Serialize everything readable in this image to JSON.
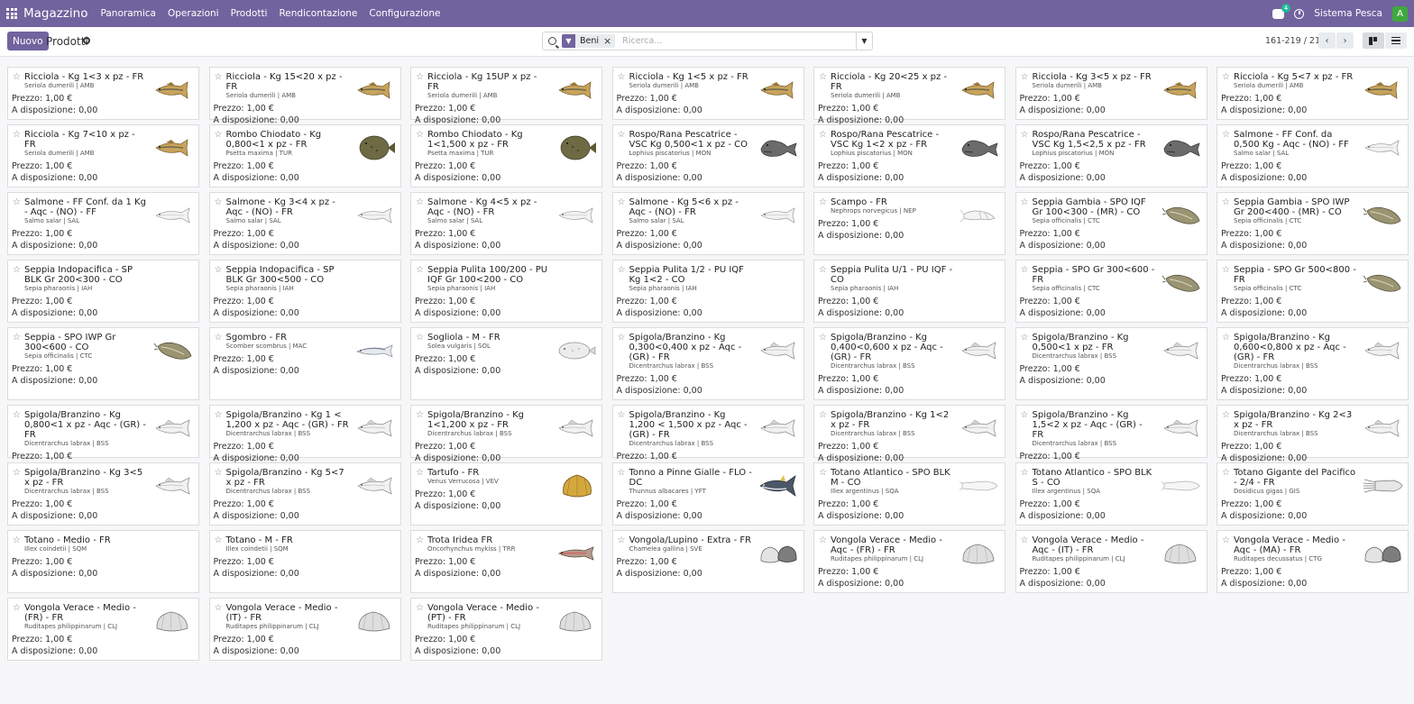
{
  "navbar": {
    "app_name": "Magazzino",
    "menu": [
      "Panoramica",
      "Operazioni",
      "Prodotti",
      "Rendicontazione",
      "Configurazione"
    ],
    "messages_count": "4",
    "company": "Sistema Pesca",
    "avatar_letter": "A"
  },
  "control": {
    "new_label": "Nuovo",
    "title": "Prodotti",
    "facet_label": "Beni",
    "search_placeholder": "Ricerca...",
    "pager": "161-219 / 219"
  },
  "labels": {
    "price_prefix": "Prezzo:",
    "stock_prefix": "A disposizione:"
  },
  "products": [
    {
      "name": "Ricciola - Kg 1<3 x pz - FR",
      "sci": "Seriola dumerili | AMB",
      "price": "1,00 €",
      "stock": "0,00",
      "img": "amberjack"
    },
    {
      "name": "Ricciola - Kg 15<20 x pz - FR",
      "sci": "Seriola dumerili | AMB",
      "price": "1,00 €",
      "stock": "0,00",
      "img": "amberjack"
    },
    {
      "name": "Ricciola - Kg 15UP x pz - FR",
      "sci": "Seriola dumerili | AMB",
      "price": "1,00 €",
      "stock": "0,00",
      "img": "amberjack"
    },
    {
      "name": "Ricciola - Kg 1<5 x pz - FR",
      "sci": "Seriola dumerili | AMB",
      "price": "1,00 €",
      "stock": "0,00",
      "img": "amberjack"
    },
    {
      "name": "Ricciola - Kg 20<25 x pz - FR",
      "sci": "Seriola dumerili | AMB",
      "price": "1,00 €",
      "stock": "0,00",
      "img": "amberjack"
    },
    {
      "name": "Ricciola - Kg 3<5 x pz - FR",
      "sci": "Seriola dumerili | AMB",
      "price": "1,00 €",
      "stock": "0,00",
      "img": "amberjack"
    },
    {
      "name": "Ricciola - Kg 5<7 x pz - FR",
      "sci": "Seriola dumerili | AMB",
      "price": "1,00 €",
      "stock": "0,00",
      "img": "amberjack"
    },
    {
      "name": "Ricciola - Kg 7<10 x pz - FR",
      "sci": "Seriola dumerili | AMB",
      "price": "1,00 €",
      "stock": "0,00",
      "img": "amberjack"
    },
    {
      "name": "Rombo Chiodato - Kg 0,800<1 x pz - FR",
      "sci": "Psetta maxima | TUR",
      "price": "1,00 €",
      "stock": "0,00",
      "img": "flatfish"
    },
    {
      "name": "Rombo Chiodato - Kg 1<1,500 x pz - FR",
      "sci": "Psetta maxima | TUR",
      "price": "1,00 €",
      "stock": "0,00",
      "img": "flatfish"
    },
    {
      "name": "Rospo/Rana Pescatrice - VSC Kg 0,500<1 x pz - CO",
      "sci": "Lophius piscatorius | MON",
      "price": "1,00 €",
      "stock": "0,00",
      "img": "monkfish"
    },
    {
      "name": "Rospo/Rana Pescatrice - VSC Kg 1<2 x pz - FR",
      "sci": "Lophius piscatorius | MON",
      "price": "1,00 €",
      "stock": "0,00",
      "img": "monkfish"
    },
    {
      "name": "Rospo/Rana Pescatrice - VSC Kg 1,5<2,5 x pz - FR",
      "sci": "Lophius piscatorius | MON",
      "price": "1,00 €",
      "stock": "0,00",
      "img": "monkfish"
    },
    {
      "name": "Salmone - FF Conf. da 0,500 Kg - Aqc - (NO) - FF",
      "sci": "Salmo salar | SAL",
      "price": "1,00 €",
      "stock": "0,00",
      "img": "salmon"
    },
    {
      "name": "Salmone - FF Conf. da 1 Kg - Aqc - (NO) - FF",
      "sci": "Salmo salar | SAL",
      "price": "1,00 €",
      "stock": "0,00",
      "img": "salmon"
    },
    {
      "name": "Salmone - Kg 3<4 x pz - Aqc - (NO) - FR",
      "sci": "Salmo salar | SAL",
      "price": "1,00 €",
      "stock": "0,00",
      "img": "salmon"
    },
    {
      "name": "Salmone - Kg 4<5 x pz - Aqc - (NO) - FR",
      "sci": "Salmo salar | SAL",
      "price": "1,00 €",
      "stock": "0,00",
      "img": "salmon"
    },
    {
      "name": "Salmone - Kg 5<6 x pz - Aqc - (NO) - FR",
      "sci": "Salmo salar | SAL",
      "price": "1,00 €",
      "stock": "0,00",
      "img": "salmon"
    },
    {
      "name": "Scampo - FR",
      "sci": "Nephrops norvegicus | NEP",
      "price": "1,00 €",
      "stock": "0,00",
      "img": "shrimp"
    },
    {
      "name": "Seppia Gambia - SPO IQF Gr 100<300 - (MR) - CO",
      "sci": "Sepia officinalis | CTC",
      "price": "1,00 €",
      "stock": "0,00",
      "img": "cuttlefish"
    },
    {
      "name": "Seppia Gambia - SPO IWP Gr 200<400 - (MR) - CO",
      "sci": "Sepia officinalis | CTC",
      "price": "1,00 €",
      "stock": "0,00",
      "img": "cuttlefish"
    },
    {
      "name": "Seppia Indopacifica - SP BLK Gr 200<300 - CO",
      "sci": "Sepia pharaonis | IAH",
      "price": "1,00 €",
      "stock": "0,00",
      "img": ""
    },
    {
      "name": "Seppia Indopacifica - SP BLK Gr 300<500 - CO",
      "sci": "Sepia pharaonis | IAH",
      "price": "1,00 €",
      "stock": "0,00",
      "img": ""
    },
    {
      "name": "Seppia Pulita 100/200 - PU IQF Gr 100<200 - CO",
      "sci": "Sepia pharaonis | IAH",
      "price": "1,00 €",
      "stock": "0,00",
      "img": ""
    },
    {
      "name": "Seppia Pulita 1/2 - PU IQF Kg 1<2 - CO",
      "sci": "Sepia pharaonis | IAH",
      "price": "1,00 €",
      "stock": "0,00",
      "img": ""
    },
    {
      "name": "Seppia Pulita U/1 - PU IQF - CO",
      "sci": "Sepia pharaonis | IAH",
      "price": "1,00 €",
      "stock": "0,00",
      "img": ""
    },
    {
      "name": "Seppia - SPO Gr 300<600 - FR",
      "sci": "Sepia officinalis | CTC",
      "price": "1,00 €",
      "stock": "0,00",
      "img": "cuttlefish"
    },
    {
      "name": "Seppia - SPO Gr 500<800 - FR",
      "sci": "Sepia officinalis | CTC",
      "price": "1,00 €",
      "stock": "0,00",
      "img": "cuttlefish"
    },
    {
      "name": "Seppia - SPO IWP Gr 300<600 - CO",
      "sci": "Sepia officinalis | CTC",
      "price": "1,00 €",
      "stock": "0,00",
      "img": "cuttlefish"
    },
    {
      "name": "Sgombro - FR",
      "sci": "Scomber scombrus | MAC",
      "price": "1,00 €",
      "stock": "0,00",
      "img": "mackerel"
    },
    {
      "name": "Sogliola - M - FR",
      "sci": "Solea vulgaris | SOL",
      "price": "1,00 €",
      "stock": "0,00",
      "img": "sole"
    },
    {
      "name": "Spigola/Branzino - Kg 0,300<0,400 x pz - Aqc - (GR) - FR",
      "sci": "Dicentrarchus labrax | BSS",
      "price": "1,00 €",
      "stock": "0,00",
      "img": "seabass"
    },
    {
      "name": "Spigola/Branzino - Kg 0,400<0,600 x pz - Aqc - (GR) - FR",
      "sci": "Dicentrarchus labrax | BSS",
      "price": "1,00 €",
      "stock": "0,00",
      "img": "seabass"
    },
    {
      "name": "Spigola/Branzino - Kg 0,500<1 x pz - FR",
      "sci": "Dicentrarchus labrax | BSS",
      "price": "1,00 €",
      "stock": "0,00",
      "img": "seabass"
    },
    {
      "name": "Spigola/Branzino - Kg 0,600<0,800 x pz - Aqc - (GR) - FR",
      "sci": "Dicentrarchus labrax | BSS",
      "price": "1,00 €",
      "stock": "0,00",
      "img": "seabass"
    },
    {
      "name": "Spigola/Branzino - Kg 0,800<1 x pz - Aqc - (GR) - FR",
      "sci": "Dicentrarchus labrax | BSS",
      "price": "1,00 €",
      "stock": "0,00",
      "img": "seabass"
    },
    {
      "name": "Spigola/Branzino - Kg 1 < 1,200 x pz - Aqc - (GR) - FR",
      "sci": "Dicentrarchus labrax | BSS",
      "price": "1,00 €",
      "stock": "0,00",
      "img": "seabass"
    },
    {
      "name": "Spigola/Branzino - Kg 1<1,200 x pz - FR",
      "sci": "Dicentrarchus labrax | BSS",
      "price": "1,00 €",
      "stock": "0,00",
      "img": "seabass"
    },
    {
      "name": "Spigola/Branzino - Kg 1,200 < 1,500 x pz - Aqc - (GR) - FR",
      "sci": "Dicentrarchus labrax | BSS",
      "price": "1,00 €",
      "stock": "0,00",
      "img": "seabass"
    },
    {
      "name": "Spigola/Branzino - Kg 1<2 x pz - FR",
      "sci": "Dicentrarchus labrax | BSS",
      "price": "1,00 €",
      "stock": "0,00",
      "img": "seabass"
    },
    {
      "name": "Spigola/Branzino - Kg 1,5<2 x pz - Aqc - (GR) - FR",
      "sci": "Dicentrarchus labrax | BSS",
      "price": "1,00 €",
      "stock": "0,00",
      "img": "seabass"
    },
    {
      "name": "Spigola/Branzino - Kg 2<3 x pz - FR",
      "sci": "Dicentrarchus labrax | BSS",
      "price": "1,00 €",
      "stock": "0,00",
      "img": "seabass"
    },
    {
      "name": "Spigola/Branzino - Kg 3<5 x pz - FR",
      "sci": "Dicentrarchus labrax | BSS",
      "price": "1,00 €",
      "stock": "0,00",
      "img": "seabass"
    },
    {
      "name": "Spigola/Branzino - Kg 5<7 x pz - FR",
      "sci": "Dicentrarchus labrax | BSS",
      "price": "1,00 €",
      "stock": "0,00",
      "img": "seabass"
    },
    {
      "name": "Tartufo - FR",
      "sci": "Venus Verrucosa | VEV",
      "price": "1,00 €",
      "stock": "0,00",
      "img": "clam-gold"
    },
    {
      "name": "Tonno a Pinne Gialle - FLO - DC",
      "sci": "Thunnus albacares | YFT",
      "price": "1,00 €",
      "stock": "0,00",
      "img": "tuna"
    },
    {
      "name": "Totano Atlantico - SPO BLK M - CO",
      "sci": "Illex argentinus | SQA",
      "price": "1,00 €",
      "stock": "0,00",
      "img": "squid-light"
    },
    {
      "name": "Totano Atlantico - SPO BLK S - CO",
      "sci": "Illex argentinus | SQA",
      "price": "1,00 €",
      "stock": "0,00",
      "img": "squid-light"
    },
    {
      "name": "Totano Gigante del Pacifico - 2/4 - FR",
      "sci": "Dosidicus gigas | GIS",
      "price": "1,00 €",
      "stock": "0,00",
      "img": "squid"
    },
    {
      "name": "Totano - Medio - FR",
      "sci": "Illex coindetii | SQM",
      "price": "1,00 €",
      "stock": "0,00",
      "img": ""
    },
    {
      "name": "Totano - M - FR",
      "sci": "Illex coindetii | SQM",
      "price": "1,00 €",
      "stock": "0,00",
      "img": ""
    },
    {
      "name": "Trota Iridea FR",
      "sci": "Oncorhynchus mykiss | TRR",
      "price": "1,00 €",
      "stock": "0,00",
      "img": "trout"
    },
    {
      "name": "Vongola/Lupino - Extra - FR",
      "sci": "Chamelea gallina | SVE",
      "price": "1,00 €",
      "stock": "0,00",
      "img": "clams-pair"
    },
    {
      "name": "Vongola Verace - Medio - Aqc - (FR) - FR",
      "sci": "Ruditapes philippinarum | CLJ",
      "price": "1,00 €",
      "stock": "0,00",
      "img": "clam"
    },
    {
      "name": "Vongola Verace - Medio - Aqc - (IT) - FR",
      "sci": "Ruditapes philippinarum | CLJ",
      "price": "1,00 €",
      "stock": "0,00",
      "img": "clam"
    },
    {
      "name": "Vongola Verace - Medio - Aqc - (MA) - FR",
      "sci": "Ruditapes decussatus | CTG",
      "price": "1,00 €",
      "stock": "0,00",
      "img": "clams-pair"
    },
    {
      "name": "Vongola Verace - Medio - (FR) - FR",
      "sci": "Ruditapes philippinarum | CLJ",
      "price": "1,00 €",
      "stock": "0,00",
      "img": "clam"
    },
    {
      "name": "Vongola Verace - Medio - (IT) - FR",
      "sci": "Ruditapes philippinarum | CLJ",
      "price": "1,00 €",
      "stock": "0,00",
      "img": "clam"
    },
    {
      "name": "Vongola Verace - Medio - (PT) - FR",
      "sci": "Ruditapes philippinarum | CLJ",
      "price": "1,00 €",
      "stock": "0,00",
      "img": "clam"
    }
  ]
}
